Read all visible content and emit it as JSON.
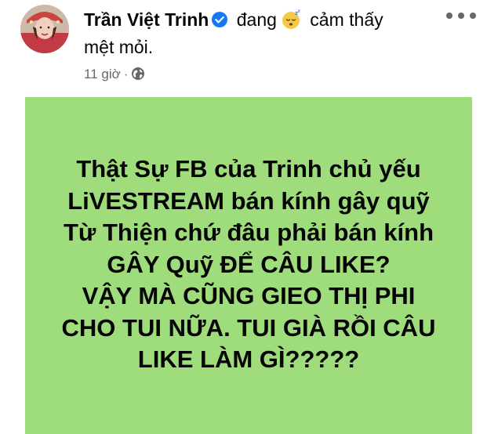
{
  "post": {
    "author_name": "Trần Việt Trinh",
    "status_prefix": "đang",
    "feeling_label_1": "cảm thấy",
    "feeling_label_2": "mệt mỏi.",
    "feeling_icon": "sleepy-face-icon",
    "timestamp": "11 giờ",
    "separator": "·",
    "privacy_icon": "globe-icon",
    "verified_icon": "verified-badge-icon",
    "more_icon": "more-options-icon",
    "background_color": "#9fdc7c",
    "verified_color": "#1877f2",
    "content_lines": [
      "Thật Sự FB của Trinh chủ yếu",
      "LiVESTREAM bán kính gây quỹ",
      "Từ Thiện chứ đâu phải bán kính",
      "GÂY Quỹ ĐỂ CÂU LIKE?",
      "VẬY MÀ CŨNG GIEO THỊ PHI",
      "CHO TUI NỮA. TUI GIÀ RỒI CÂU",
      "LIKE LÀM GÌ?????"
    ]
  }
}
